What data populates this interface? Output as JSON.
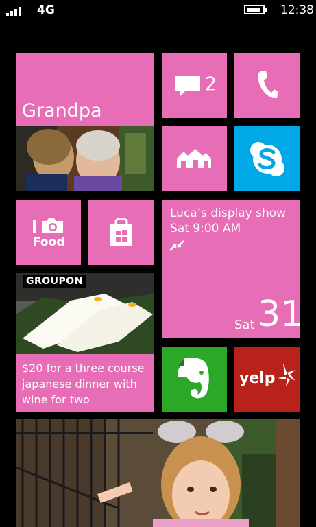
{
  "status_bar": {
    "network": "4G",
    "time": "12:38",
    "signal_icon": "signal-bars-icon",
    "battery_icon": "battery-icon",
    "battery_level": 0.85
  },
  "tiles": {
    "grandpa": {
      "name": "Grandpa",
      "photo": "people-photo"
    },
    "messaging": {
      "icon": "message-bubble-icon",
      "count": "2"
    },
    "phone": {
      "icon": "phone-icon"
    },
    "family_room": {
      "icon": "houses-icon"
    },
    "skype": {
      "icon": "skype-icon"
    },
    "camera": {
      "icon": "camera-icon",
      "label": "Food"
    },
    "store": {
      "icon": "shopping-bag-icon"
    },
    "calendar": {
      "event_title": "Luca’s display show",
      "event_time": "Sat 9:00 AM",
      "day_of_week": "Sat",
      "day_number": "31",
      "icon": "arrows-icon"
    },
    "groupon": {
      "brand": "GROUPON",
      "deal_text": "$20 for a three course japanese dinner with wine for two"
    },
    "evernote": {
      "icon": "elephant-icon"
    },
    "yelp": {
      "logo": "yelp"
    },
    "photos": {
      "photo": "girl-photo"
    }
  },
  "colors": {
    "tile_pink": "#e76db7",
    "skype_blue": "#00a8e8",
    "evernote_green": "#2ca829",
    "yelp_red": "#b8221b",
    "background": "#000000"
  }
}
